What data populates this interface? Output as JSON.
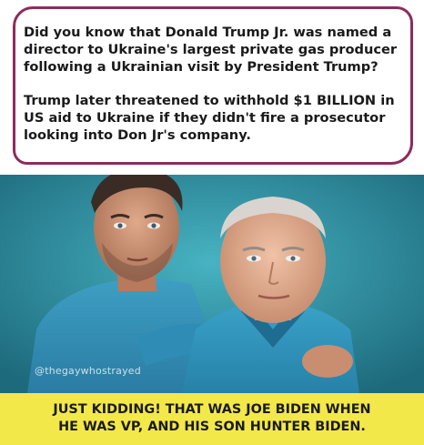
{
  "bubble": {
    "paragraph1_lines": [
      "Did you know that Donald Trump Jr. was named a",
      "director to Ukraine's largest private gas producer",
      "following a Ukrainian visit by President Trump?"
    ],
    "paragraph2_lines": [
      "Trump later threatened to withhold $1 BILLION in",
      "US aid to Ukraine if they didn't fire a prosecutor",
      "looking into Don Jr's company."
    ],
    "border_color": "#8e2b5c"
  },
  "photo": {
    "watermark": "@thegaywhostrayed",
    "background_color": "#2b8a9e"
  },
  "caption": {
    "line1": "JUST KIDDING! THAT WAS JOE BIDEN WHEN",
    "line2": "HE WAS VP, AND HIS SON HUNTER BIDEN.",
    "background_color": "#f3e84a"
  }
}
